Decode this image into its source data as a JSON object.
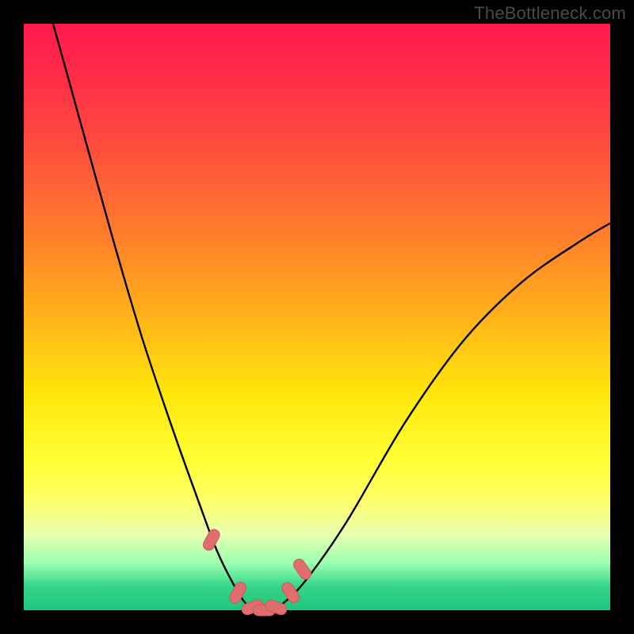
{
  "watermark": "TheBottleneck.com",
  "colors": {
    "background": "#000000",
    "curve": "#000000",
    "marker": "#e16e6e",
    "marker_border": "#c95a5a"
  },
  "chart_data": {
    "type": "line",
    "title": "",
    "xlabel": "",
    "ylabel": "",
    "xlim": [
      0,
      100
    ],
    "ylim": [
      0,
      100
    ],
    "grid": false,
    "legend": false,
    "note": "V-shaped bottleneck curve; y is bottleneck percentage. Markers cluster at the trough.",
    "series": [
      {
        "name": "bottleneck-curve",
        "x": [
          5,
          10,
          15,
          20,
          25,
          30,
          33,
          36,
          38,
          40,
          42,
          44,
          48,
          55,
          65,
          75,
          85,
          95,
          100
        ],
        "y": [
          100,
          82,
          64,
          47,
          32,
          18,
          10,
          4,
          1,
          0,
          0,
          1,
          5,
          15,
          32,
          46,
          56,
          63,
          66
        ]
      }
    ],
    "markers": {
      "name": "highlighted-range",
      "x": [
        32,
        36.5,
        39,
        41,
        43,
        45.5,
        47.5
      ],
      "y": [
        12,
        3,
        0.5,
        0,
        0.5,
        3,
        7
      ]
    }
  }
}
